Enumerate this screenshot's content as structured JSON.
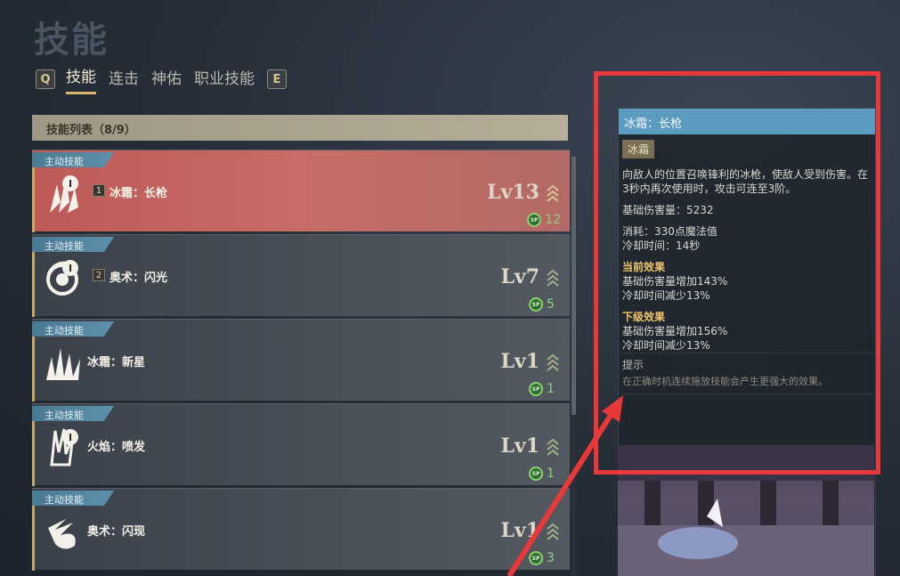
{
  "page": {
    "title": "技能"
  },
  "tabs": {
    "prev_key": "Q",
    "next_key": "E",
    "items": [
      {
        "label": "技能",
        "active": true
      },
      {
        "label": "连击",
        "active": false
      },
      {
        "label": "神佑",
        "active": false
      },
      {
        "label": "职业技能",
        "active": false
      }
    ]
  },
  "skill_list": {
    "header": "技能列表（8/9）",
    "items": [
      {
        "tag": "主动技能",
        "slot": "1",
        "name": "冰霜：长枪",
        "level": "Lv13",
        "sp": "12",
        "icon": "ice-spear-icon",
        "selected": true
      },
      {
        "tag": "主动技能",
        "slot": "2",
        "name": "奥术：闪光",
        "level": "Lv7",
        "sp": "5",
        "icon": "arcane-flash-icon",
        "selected": false
      },
      {
        "tag": "主动技能",
        "slot": "",
        "name": "冰霜：新星",
        "level": "Lv1",
        "sp": "1",
        "icon": "frost-nova-icon",
        "selected": false
      },
      {
        "tag": "主动技能",
        "slot": "",
        "name": "火焰：喷发",
        "level": "Lv1",
        "sp": "1",
        "icon": "fire-eruption-icon",
        "selected": false
      },
      {
        "tag": "主动技能",
        "slot": "",
        "name": "奥术：闪现",
        "level": "Lv1",
        "sp": "3",
        "icon": "arcane-blink-icon",
        "selected": false
      }
    ]
  },
  "detail": {
    "title": "冰霜：长枪",
    "element": "冰霜",
    "description": "向敌人的位置召唤锋利的冰枪，使敌人受到伤害。在3秒内再次使用时，攻击可连至3阶。",
    "base_damage": "基础伤害量：5232",
    "cost": "消耗：330点魔法值",
    "cooldown": "冷却时间：14秒",
    "current_title": "当前效果",
    "current_damage": "基础伤害量增加143%",
    "current_cooldown": "冷却时间减少13%",
    "next_title": "下级效果",
    "next_damage": "基础伤害量增加156%",
    "next_cooldown": "冷却时间减少13%",
    "hint_title": "提示",
    "hint_text": "在正确时机连续施放技能会产生更强大的效果。"
  },
  "colors": {
    "selected_row": "#c0605d",
    "detail_title_bar": "#5b9bc0",
    "highlight_box": "#e8383a",
    "sp_green": "#8fd07a"
  }
}
